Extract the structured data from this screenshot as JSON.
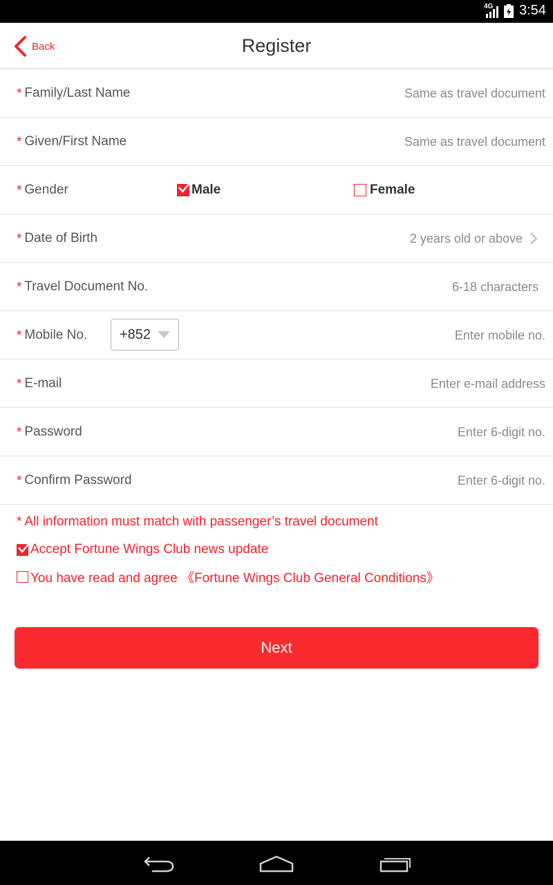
{
  "status_bar": {
    "network": "4G",
    "time": "3:54"
  },
  "header": {
    "back_label": "Back",
    "title": "Register"
  },
  "form": {
    "required_mark": "*",
    "family_name": {
      "label": "Family/Last Name",
      "placeholder": "Same as travel document"
    },
    "given_name": {
      "label": "Given/First Name",
      "placeholder": "Same as travel document"
    },
    "gender": {
      "label": "Gender",
      "options": [
        {
          "label": "Male",
          "checked": true
        },
        {
          "label": "Female",
          "checked": false
        }
      ]
    },
    "dob": {
      "label": "Date of Birth",
      "placeholder": "2 years old or above"
    },
    "travel_doc": {
      "label": "Travel Document No.",
      "placeholder": "6-18 characters"
    },
    "mobile": {
      "label": "Mobile No.",
      "country_code": "+852",
      "placeholder": "Enter mobile no."
    },
    "email": {
      "label": "E-mail",
      "placeholder": "Enter e-mail address"
    },
    "password": {
      "label": "Password",
      "placeholder": "Enter 6-digit no."
    },
    "confirm_password": {
      "label": "Confirm Password",
      "placeholder": "Enter 6-digit no."
    }
  },
  "notice": "All information must match with passenger’s travel document",
  "news_checkbox": {
    "label": "Accept Fortune Wings Club news update",
    "checked": true
  },
  "terms_checkbox": {
    "label": "You have read and agree 《Fortune Wings Club General Conditions》",
    "checked": false
  },
  "next_button": "Next",
  "colors": {
    "accent": "#f5222d",
    "button": "#fb2a2e",
    "placeholder": "#8a8a8a"
  },
  "nav_bar": {
    "icons": [
      "back-icon",
      "home-icon",
      "recent-apps-icon"
    ]
  }
}
